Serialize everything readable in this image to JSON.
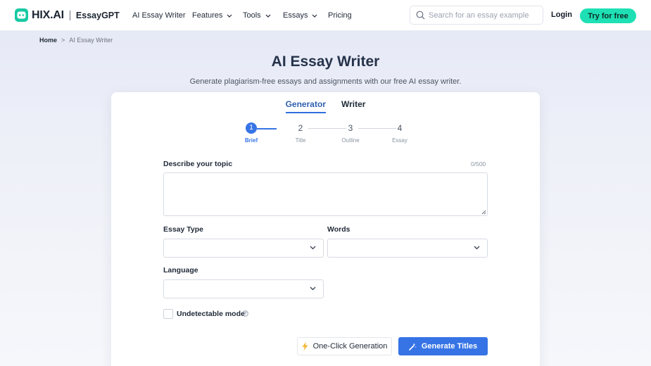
{
  "header": {
    "logo_text": "HIX.AI",
    "logo_sub": "EssayGPT",
    "nav": [
      {
        "label": "AI Essay Writer",
        "has_dropdown": false
      },
      {
        "label": "Features",
        "has_dropdown": true
      },
      {
        "label": "Tools",
        "has_dropdown": true
      },
      {
        "label": "Essays",
        "has_dropdown": true
      },
      {
        "label": "Pricing",
        "has_dropdown": false
      }
    ],
    "search": {
      "placeholder": "Search for an essay example",
      "value": ""
    },
    "login_label": "Login",
    "cta_label": "Try for free"
  },
  "breadcrumb": {
    "home": "Home",
    "separator": ">",
    "current": "AI Essay Writer"
  },
  "hero": {
    "title": "AI Essay Writer",
    "subtitle": "Generate plagiarism-free essays and assignments with our free AI essay writer."
  },
  "card": {
    "tabs": [
      {
        "label": "Generator",
        "active": true
      },
      {
        "label": "Writer",
        "active": false
      }
    ],
    "steps": [
      {
        "number": "1",
        "label": "Brief",
        "active": true
      },
      {
        "number": "2",
        "label": "Title",
        "active": false
      },
      {
        "number": "3",
        "label": "Outline",
        "active": false
      },
      {
        "number": "4",
        "label": "Essay",
        "active": false
      }
    ],
    "topic": {
      "label": "Describe your topic",
      "counter": "0/500",
      "value": ""
    },
    "essay_type": {
      "label": "Essay Type",
      "value": ""
    },
    "words": {
      "label": "Words",
      "value": ""
    },
    "language": {
      "label": "Language",
      "value": ""
    },
    "undetectable": {
      "label": "Undetectable mode",
      "checked": false
    },
    "one_click_label": "One-Click Generation",
    "generate_label": "Generate Titles"
  },
  "colors": {
    "brand_green": "#1ee0b4",
    "accent_blue": "#3674e6",
    "title_navy": "#26334a"
  }
}
